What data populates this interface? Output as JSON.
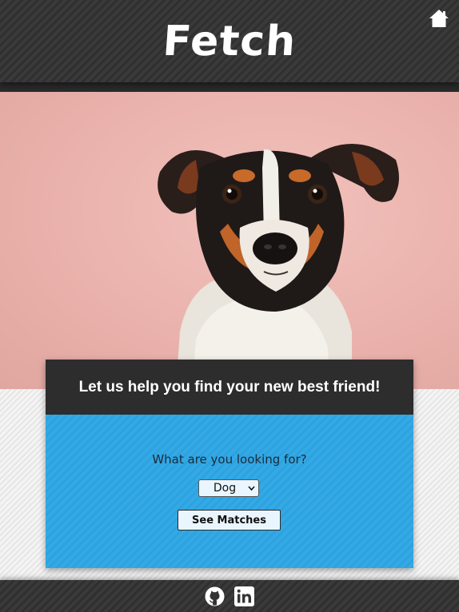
{
  "header": {
    "brand": "Fetch",
    "home_icon": "home-icon"
  },
  "hero": {
    "image": "dog-portrait",
    "background_color": "#eab2ac"
  },
  "card": {
    "heading": "Let us help you find your new best friend!",
    "question": "What are you looking for?",
    "select": {
      "value": "Dog"
    },
    "button_label": "See Matches",
    "accent_color": "#33a9e6"
  },
  "footer": {
    "icons": [
      "github-icon",
      "linkedin-icon"
    ]
  }
}
